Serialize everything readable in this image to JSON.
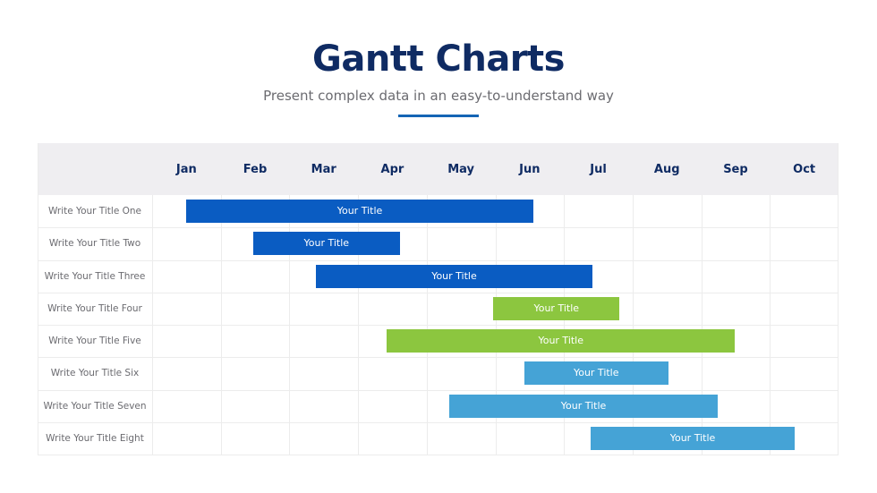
{
  "header": {
    "title": "Gantt Charts",
    "subtitle": "Present complex data in an easy-to-understand way",
    "accent_color": "#1565b5"
  },
  "chart_data": {
    "type": "gantt",
    "title": "Gantt Charts",
    "subtitle": "Present complex data in an easy-to-understand way",
    "xlabel": "",
    "ylabel": "",
    "x_unit": "months (0 = start of Jan)",
    "xlim": [
      0,
      10
    ],
    "categories": [
      "Jan",
      "Feb",
      "Mar",
      "Apr",
      "May",
      "Jun",
      "Jul",
      "Aug",
      "Sep",
      "Oct"
    ],
    "grid": true,
    "legend": "none",
    "colors": {
      "dark_blue": "#0a5cc2",
      "green": "#8cc63f",
      "light_blue": "#45a3d6"
    },
    "tasks": [
      {
        "label": "Write Your Title One",
        "bar_text": "Your Title",
        "start": 0.5,
        "end": 5.55,
        "color": "#0a5cc2"
      },
      {
        "label": "Write Your Title Two",
        "bar_text": "Your Title",
        "start": 1.47,
        "end": 3.61,
        "color": "#0a5cc2"
      },
      {
        "label": "Write Your Title Three",
        "bar_text": "Your Title",
        "start": 2.39,
        "end": 6.41,
        "color": "#0a5cc2"
      },
      {
        "label": "Write Your Title Four",
        "bar_text": "Your Title",
        "start": 4.97,
        "end": 6.81,
        "color": "#8cc63f"
      },
      {
        "label": "Write Your Title Five",
        "bar_text": "Your Title",
        "start": 3.42,
        "end": 8.49,
        "color": "#8cc63f"
      },
      {
        "label": "Write Your Title Six",
        "bar_text": "Your Title",
        "start": 5.42,
        "end": 7.52,
        "color": "#45a3d6"
      },
      {
        "label": "Write Your Title Seven",
        "bar_text": "Your Title",
        "start": 4.33,
        "end": 8.24,
        "color": "#45a3d6"
      },
      {
        "label": "Write Your Title Eight",
        "bar_text": "Your Title",
        "start": 6.39,
        "end": 9.36,
        "color": "#45a3d6"
      }
    ]
  }
}
